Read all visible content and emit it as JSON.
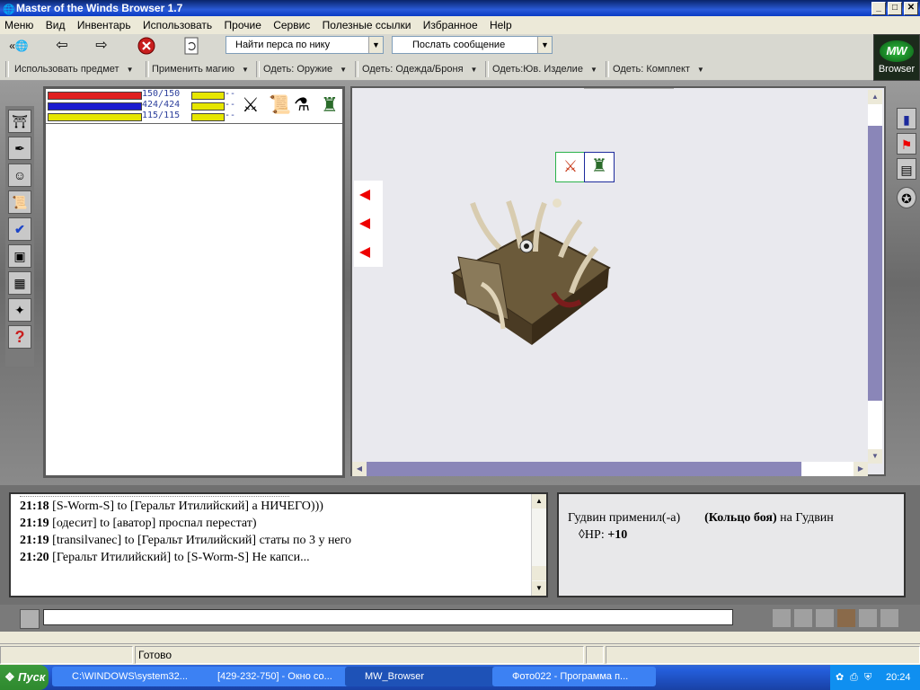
{
  "window": {
    "title": "Master of the Winds Browser 1.7",
    "min_label": "_",
    "max_label": "□",
    "close_label": "✕"
  },
  "menu": [
    "Меню",
    "Вид",
    "Инвентарь",
    "Использовать",
    "Прочие",
    "Сервис",
    "Полезные ссылки",
    "Избранное",
    "Help"
  ],
  "toolbar": {
    "find_combo": "Найти перса по нику",
    "message_combo": "Послать сообщение",
    "logo_text": "Browser",
    "logo_abbr": "MW"
  },
  "toolbar2": [
    "Использовать предмет",
    "Применить магию",
    "Одеть: Оружие",
    "Одеть: Одежда/Броня",
    "Одеть:Юв. Изделие",
    "Одеть: Комплект"
  ],
  "stats": {
    "hp": {
      "text": "150/150",
      "fill": 1.0,
      "color": "#e02020"
    },
    "mp": {
      "text": "424/424",
      "fill": 1.0,
      "color": "#1c1ccf"
    },
    "en": {
      "text": "115/115",
      "fill": 1.0,
      "color": "#e6e600"
    },
    "small_dash": "--"
  },
  "chat": {
    "lines": [
      {
        "time": "21:18",
        "text": "[S-Worm-S] to [Геральт Итилийский] а НИЧЕГО)))"
      },
      {
        "time": "21:19",
        "text": "[одесит] to [аватор] проспал перестат)"
      },
      {
        "time": "21:19",
        "text": "[transilvanec] to [Геральт Итилийский] статы по 3 у него"
      },
      {
        "time": "21:20",
        "text": "[Геральт Итилийский] to [S-Worm-S] Не капси..."
      }
    ]
  },
  "info": {
    "actor": "Гудвин применил(-а)",
    "item": "(Кольцо боя)",
    "on": "на",
    "target": "Гудвин",
    "hp_label": "HP:",
    "hp_value": "+10"
  },
  "status": {
    "text": "Готово"
  },
  "taskbar": {
    "start": "Пуск",
    "tasks": [
      "C:\\WINDOWS\\system32...",
      "[429-232-750] - Окно со...",
      "MW_Browser",
      "Фото022 - Программа п..."
    ],
    "clock": "20:24"
  }
}
